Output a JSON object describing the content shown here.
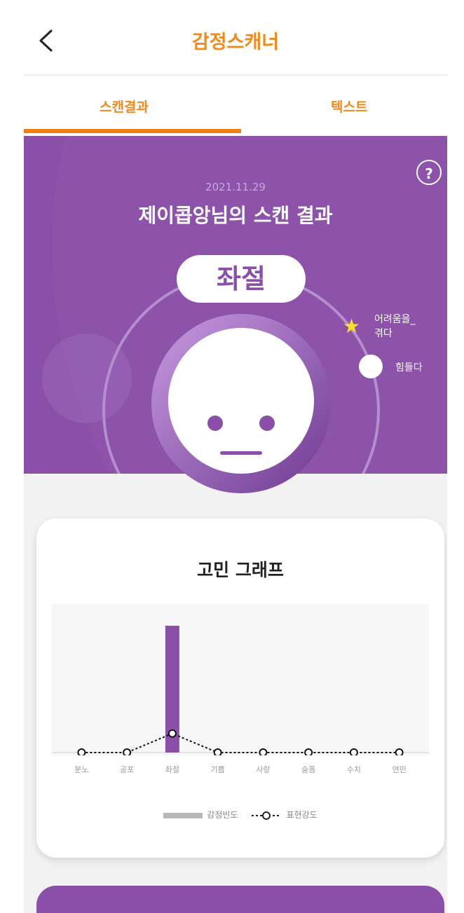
{
  "header": {
    "title": "감정스캐너",
    "back_icon": "chevron-left-icon"
  },
  "tabs": [
    {
      "label": "스캔결과",
      "active": true
    },
    {
      "label": "텍스트",
      "active": false
    }
  ],
  "scan": {
    "date": "2021.11.29",
    "title": "제이콥앙님의 스캔 결과",
    "emotion": "좌절",
    "help": "?",
    "keywords": [
      {
        "label": "어려움을_\n겪다",
        "marker": "star-icon"
      },
      {
        "label": "힘들다",
        "marker": "dot-icon"
      }
    ]
  },
  "graph": {
    "title": "고민 그래프",
    "legend": {
      "frequency": "감정빈도",
      "intensity": "표현강도"
    }
  },
  "chart_data": {
    "type": "bar",
    "categories": [
      "분노",
      "공포",
      "좌절",
      "기쁨",
      "사랑",
      "슬픔",
      "수치",
      "연민"
    ],
    "series": [
      {
        "name": "감정빈도",
        "values": [
          0,
          0,
          1,
          0,
          0,
          0,
          0,
          0
        ]
      },
      {
        "name": "표현강도",
        "values": [
          0,
          0,
          0.15,
          0,
          0,
          0,
          0,
          0
        ]
      }
    ],
    "ylim": [
      0,
      1.05
    ],
    "colors": {
      "bar": "#8a4fa8",
      "line": "#111111"
    }
  },
  "colors": {
    "accent": "#ef8a1d",
    "primary": "#8a4fa8"
  }
}
